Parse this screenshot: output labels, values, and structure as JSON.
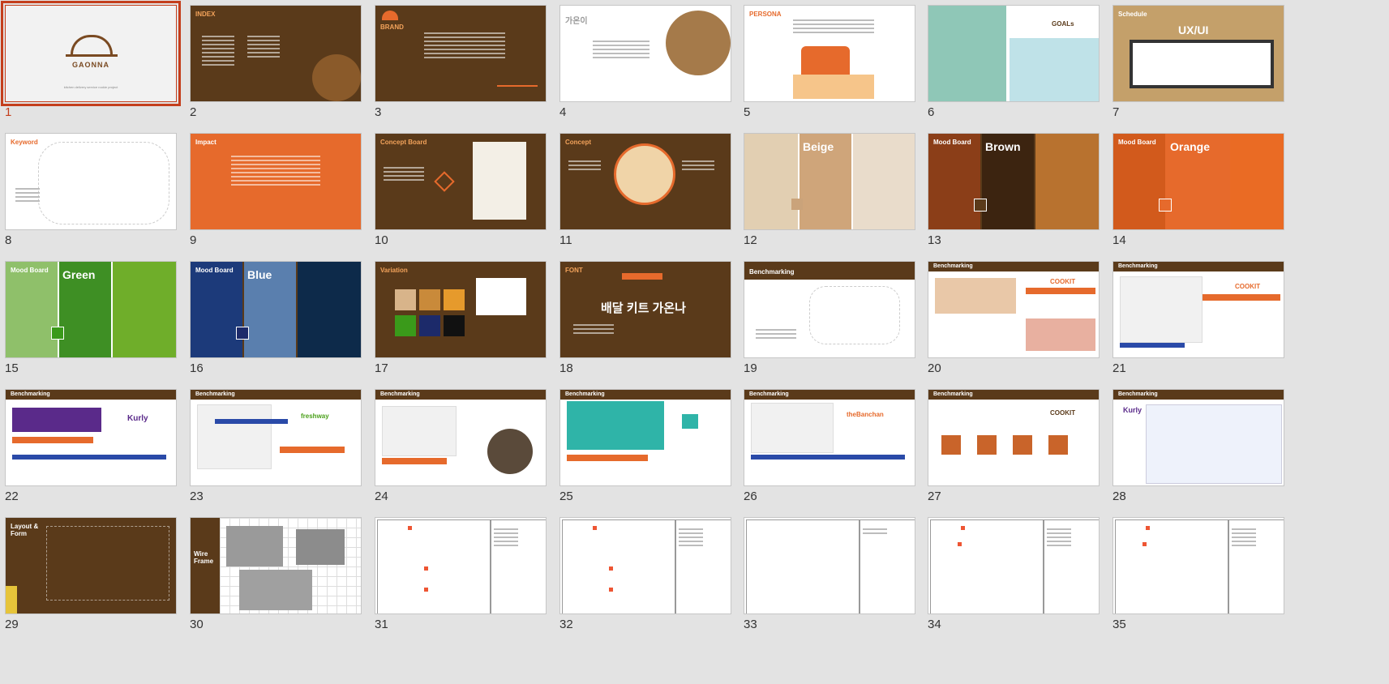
{
  "slides": [
    {
      "n": "1",
      "theme": "grey",
      "selected": true,
      "brand": "GAONNA",
      "sub": "kitchen delivery service  rookie project"
    },
    {
      "n": "2",
      "theme": "brown",
      "title": "INDEX"
    },
    {
      "n": "3",
      "theme": "brown",
      "title": "BRAND"
    },
    {
      "n": "4",
      "theme": "light",
      "title": "가온이"
    },
    {
      "n": "5",
      "theme": "light",
      "title": "PERSONA"
    },
    {
      "n": "6",
      "theme": "light",
      "title": "GOALs"
    },
    {
      "n": "7",
      "theme": "tan",
      "title": "Schedule",
      "big": "UX/UI"
    },
    {
      "n": "8",
      "theme": "light",
      "title": "Keyword"
    },
    {
      "n": "9",
      "theme": "orange",
      "title": "Impact"
    },
    {
      "n": "10",
      "theme": "brown",
      "title": "Concept Board"
    },
    {
      "n": "11",
      "theme": "brown",
      "title": "Concept"
    },
    {
      "n": "12",
      "theme": "light",
      "title": "Mood Board",
      "big": "Beige"
    },
    {
      "n": "13",
      "theme": "brown",
      "title": "Mood Board",
      "big": "Brown"
    },
    {
      "n": "14",
      "theme": "orange",
      "title": "Mood Board",
      "big": "Orange"
    },
    {
      "n": "15",
      "theme": "green",
      "title": "Mood Board",
      "big": "Green"
    },
    {
      "n": "16",
      "theme": "blue",
      "title": "Mood Board",
      "big": "Blue"
    },
    {
      "n": "17",
      "theme": "brown",
      "title": "Variation"
    },
    {
      "n": "18",
      "theme": "brown",
      "title": "FONT",
      "big": "배달 키트 가온나"
    },
    {
      "n": "19",
      "theme": "light",
      "title": "Benchmarking"
    },
    {
      "n": "20",
      "theme": "light",
      "title": "Benchmarking",
      "big": "COOKIT"
    },
    {
      "n": "21",
      "theme": "light",
      "title": "Benchmarking",
      "big": "COOKIT"
    },
    {
      "n": "22",
      "theme": "light",
      "title": "Benchmarking",
      "big": "Kurly"
    },
    {
      "n": "23",
      "theme": "light",
      "title": "Benchmarking",
      "big": "freshway"
    },
    {
      "n": "24",
      "theme": "light",
      "title": "Benchmarking"
    },
    {
      "n": "25",
      "theme": "light",
      "title": "Benchmarking"
    },
    {
      "n": "26",
      "theme": "light",
      "title": "Benchmarking",
      "big": "theBanchan"
    },
    {
      "n": "27",
      "theme": "light",
      "title": "Benchmarking",
      "big": "COOKIT"
    },
    {
      "n": "28",
      "theme": "light",
      "title": "Benchmarking",
      "big": "Kurly"
    },
    {
      "n": "29",
      "theme": "brown",
      "title": "Layout & Form"
    },
    {
      "n": "30",
      "theme": "grid",
      "title": "Wire Frame"
    },
    {
      "n": "31",
      "theme": "white",
      "title": ""
    },
    {
      "n": "32",
      "theme": "white",
      "title": ""
    },
    {
      "n": "33",
      "theme": "white",
      "title": ""
    },
    {
      "n": "34",
      "theme": "white",
      "title": ""
    },
    {
      "n": "35",
      "theme": "white",
      "title": ""
    }
  ],
  "colors": {
    "accent": "#c43e1c",
    "brown": "#5a3a1a",
    "orange": "#e66a2c"
  }
}
